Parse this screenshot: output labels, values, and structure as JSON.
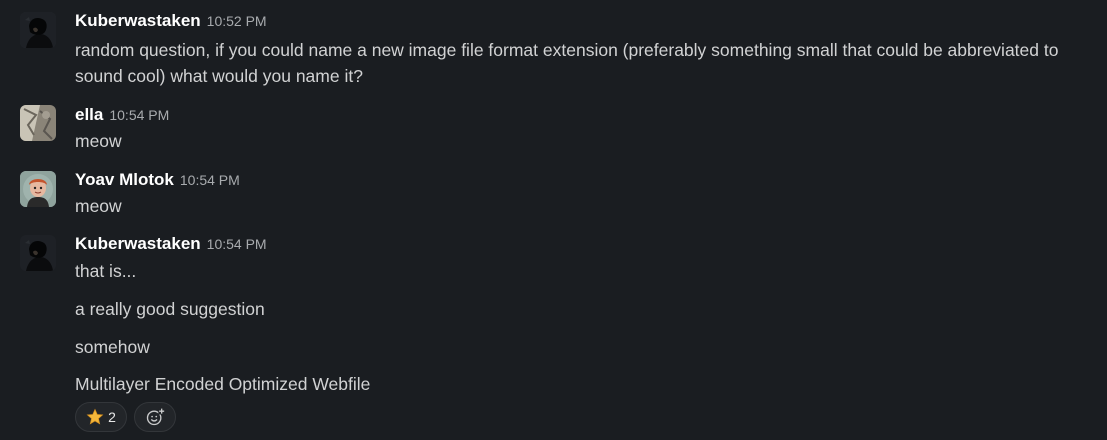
{
  "messages": [
    {
      "author": "Kuberwastaken",
      "time": "10:52 PM",
      "lines": [
        "random question, if you could name a new image file format extension (preferably something small that could be abbreviated to sound cool) what would you name it?"
      ]
    },
    {
      "author": "ella",
      "time": "10:54 PM",
      "lines": [
        "meow"
      ]
    },
    {
      "author": "Yoav Mlotok",
      "time": "10:54 PM",
      "lines": [
        "meow"
      ]
    },
    {
      "author": "Kuberwastaken",
      "time": "10:54 PM",
      "lines": [
        "that is...",
        "a really good suggestion",
        "somehow",
        "Multilayer Encoded Optimized Webfile"
      ]
    }
  ],
  "reactions": [
    {
      "emoji": "star",
      "count": "2"
    }
  ],
  "colors": {
    "background": "#1a1d21",
    "author": "#ffffff",
    "text": "#d1d2d3",
    "timestamp": "#a8abae"
  }
}
